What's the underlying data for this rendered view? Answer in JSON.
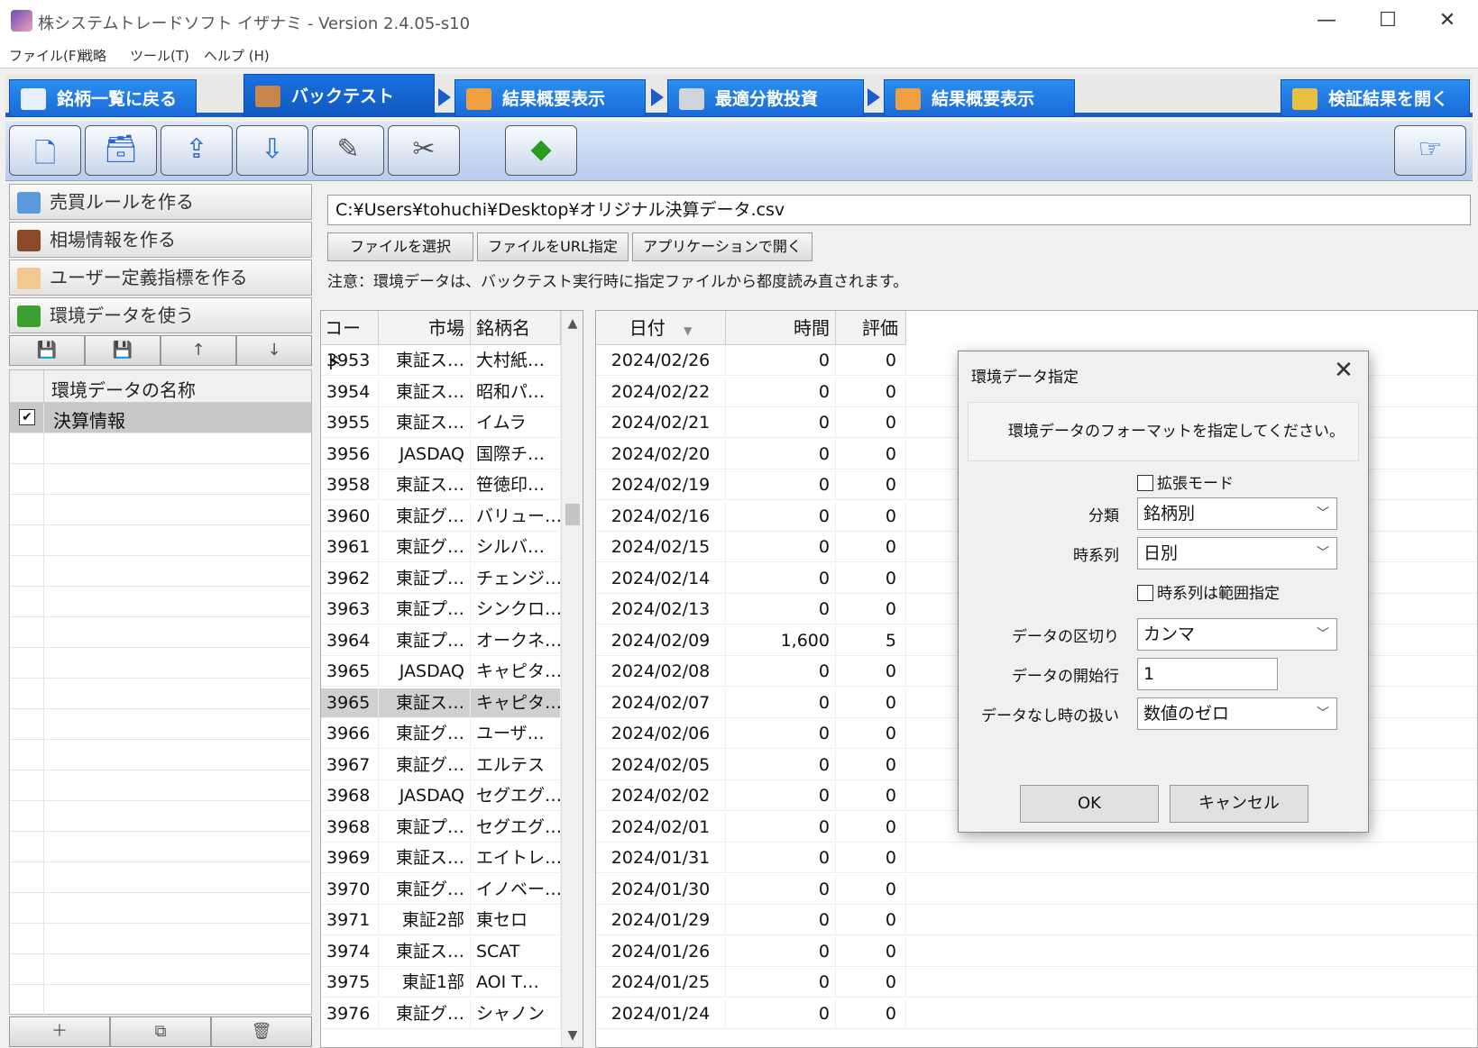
{
  "window": {
    "title": "株システムトレードソフト イザナミ - Version 2.4.05-s10",
    "minimize": "—",
    "maximize": "☐",
    "close": "✕"
  },
  "menu": [
    "ファイル(F)",
    "戦略",
    "ツール(T)",
    "ヘルプ (H)"
  ],
  "tabs": [
    {
      "label": "銘柄一覧に戻る",
      "icon": "eye-icon"
    },
    {
      "label": "バックテスト",
      "icon": "bag-icon"
    },
    {
      "label": "結果概要表示",
      "icon": "hand-icon"
    },
    {
      "label": "最適分散投資",
      "icon": "calculator-icon"
    },
    {
      "label": "結果概要表示",
      "icon": "chart-icon"
    },
    {
      "label": "検証結果を開く",
      "icon": "trophy-icon"
    }
  ],
  "left": {
    "buttons": [
      {
        "label": "売買ルールを作る",
        "icon": "rule-icon"
      },
      {
        "label": "相場情報を作る",
        "icon": "board-icon"
      },
      {
        "label": "ユーザー定義指標を作る",
        "icon": "user-icon"
      },
      {
        "label": "環境データを使う",
        "icon": "sprout-icon"
      }
    ],
    "list_header": "環境データの名称",
    "list_items": [
      {
        "label": "決算情報",
        "checked": "✔"
      }
    ]
  },
  "main": {
    "path": "C:¥Users¥tohuchi¥Desktop¥オリジナル決算データ.csv",
    "buttons": [
      "ファイルを選択",
      "ファイルをURL指定",
      "アプリケーションで開く"
    ],
    "note": "注意：環境データは、バックテスト実行時に指定ファイルから都度読み直されます。"
  },
  "stock_grid": {
    "headers": [
      "コード",
      "市場",
      "銘柄名"
    ],
    "rows": [
      [
        "3953",
        "東証ス…",
        "大村紙…"
      ],
      [
        "3954",
        "東証ス…",
        "昭和パ…"
      ],
      [
        "3955",
        "東証ス…",
        "イムラ"
      ],
      [
        "3956",
        "JASDAQ",
        "国際チ…"
      ],
      [
        "3958",
        "東証ス…",
        "笹徳印…"
      ],
      [
        "3960",
        "東証グ…",
        "バリュー…"
      ],
      [
        "3961",
        "東証グ…",
        "シルバ…"
      ],
      [
        "3962",
        "東証プ…",
        "チェンジ…"
      ],
      [
        "3963",
        "東証プ…",
        "シンクロ…"
      ],
      [
        "3964",
        "東証プ…",
        "オークネ…"
      ],
      [
        "3965",
        "JASDAQ",
        "キャピタ…"
      ],
      [
        "3965",
        "東証ス…",
        "キャピタ…"
      ],
      [
        "3966",
        "東証グ…",
        "ユーザ…"
      ],
      [
        "3967",
        "東証グ…",
        "エルテス"
      ],
      [
        "3968",
        "JASDAQ",
        "セグエグ…"
      ],
      [
        "3968",
        "東証プ…",
        "セグエグ…"
      ],
      [
        "3969",
        "東証ス…",
        "エイトレ…"
      ],
      [
        "3970",
        "東証グ…",
        "イノベー…"
      ],
      [
        "3971",
        "東証2部",
        "東セロ"
      ],
      [
        "3974",
        "東証ス…",
        "SCAT"
      ],
      [
        "3975",
        "東証1部",
        "AOI T…"
      ],
      [
        "3976",
        "東証グ…",
        "シャノン"
      ]
    ]
  },
  "data_grid": {
    "headers": [
      "日付",
      "時間",
      "評価"
    ],
    "rows": [
      [
        "2024/02/26",
        "0",
        "0"
      ],
      [
        "2024/02/22",
        "0",
        "0"
      ],
      [
        "2024/02/21",
        "0",
        "0"
      ],
      [
        "2024/02/20",
        "0",
        "0"
      ],
      [
        "2024/02/19",
        "0",
        "0"
      ],
      [
        "2024/02/16",
        "0",
        "0"
      ],
      [
        "2024/02/15",
        "0",
        "0"
      ],
      [
        "2024/02/14",
        "0",
        "0"
      ],
      [
        "2024/02/13",
        "0",
        "0"
      ],
      [
        "2024/02/09",
        "1,600",
        "5"
      ],
      [
        "2024/02/08",
        "0",
        "0"
      ],
      [
        "2024/02/07",
        "0",
        "0"
      ],
      [
        "2024/02/06",
        "0",
        "0"
      ],
      [
        "2024/02/05",
        "0",
        "0"
      ],
      [
        "2024/02/02",
        "0",
        "0"
      ],
      [
        "2024/02/01",
        "0",
        "0"
      ],
      [
        "2024/01/31",
        "0",
        "0"
      ],
      [
        "2024/01/30",
        "0",
        "0"
      ],
      [
        "2024/01/29",
        "0",
        "0"
      ],
      [
        "2024/01/26",
        "0",
        "0"
      ],
      [
        "2024/01/25",
        "0",
        "0"
      ],
      [
        "2024/01/24",
        "0",
        "0"
      ]
    ]
  },
  "dialog": {
    "title": "環境データ指定",
    "message": "環境データのフォーマットを指定してください。",
    "extended_mode": "拡張モード",
    "category_label": "分類",
    "category_value": "銘柄別",
    "series_label": "時系列",
    "series_value": "日別",
    "range_label": "時系列は範囲指定",
    "delimiter_label": "データの区切り",
    "delimiter_value": "カンマ",
    "start_row_label": "データの開始行",
    "start_row_value": "1",
    "missing_label": "データなし時の扱い",
    "missing_value": "数値のゼロ",
    "ok": "OK",
    "cancel": "キャンセル"
  },
  "colors": {
    "tab_blue": "#1a6ad8",
    "toolbar": "#c8d8f0",
    "selection": "#d0d0d0"
  }
}
